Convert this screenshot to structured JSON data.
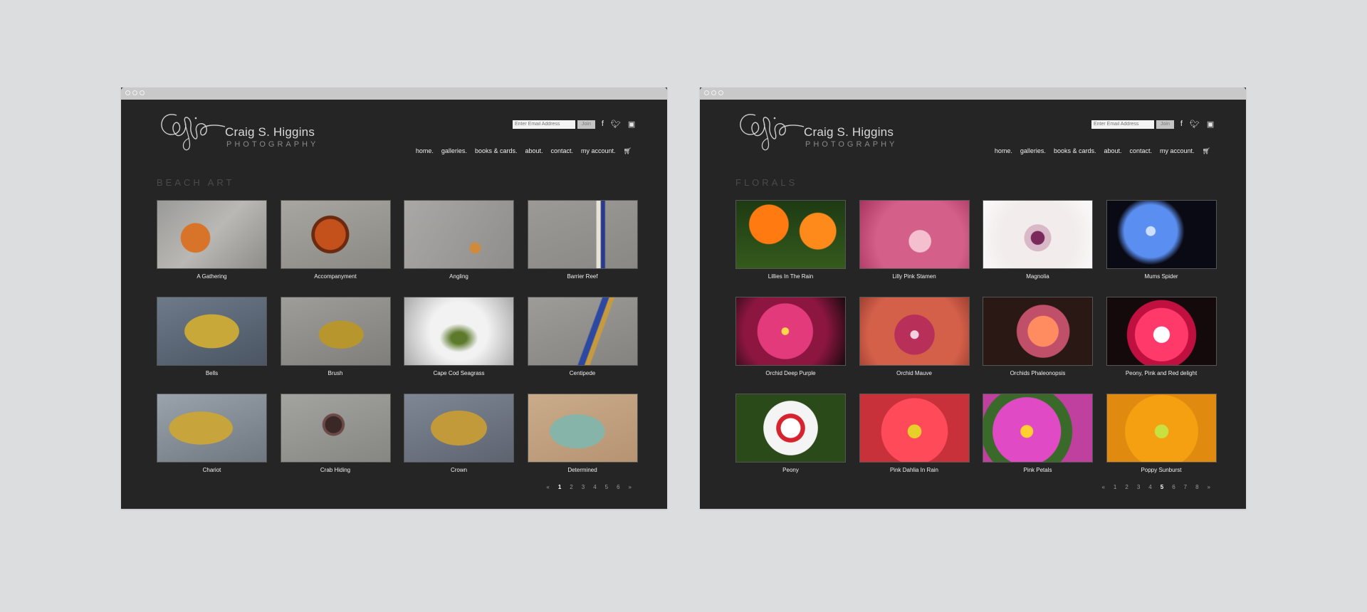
{
  "brand": {
    "name": "Craig S. Higgins",
    "sub": "PHOTOGRAPHY"
  },
  "signup": {
    "placeholder": "Enter Email Address",
    "button": "Join"
  },
  "social": [
    "facebook-icon",
    "twitter-icon",
    "instagram-icon"
  ],
  "nav": [
    "home.",
    "galleries.",
    "books & cards.",
    "about.",
    "contact.",
    "my account."
  ],
  "windows": [
    {
      "title": "BEACH ART",
      "items": [
        "A Gathering",
        "Accompanyment",
        "Angling",
        "Barrier Reef",
        "Bells",
        "Brush",
        "Cape Cod Seagrass",
        "Centipede",
        "Chariot",
        "Crab Hiding",
        "Crown",
        "Determined"
      ],
      "pager": {
        "prev": "«",
        "pages": [
          "1",
          "2",
          "3",
          "4",
          "5",
          "6"
        ],
        "current": "1",
        "next": "»"
      }
    },
    {
      "title": "FLORALS",
      "items": [
        "Lillies In The Rain",
        "Lilly Pink Stamen",
        "Magnolia",
        "Mums Spider",
        "Orchid Deep Purple",
        "Orchid Mauve",
        "Orchids Phaleonopsis",
        "Peony, Pink and Red delight",
        "Peony",
        "Pink Dahlia In Rain",
        "Pink Petals",
        "Poppy Sunburst"
      ],
      "pager": {
        "prev": "«",
        "pages": [
          "1",
          "2",
          "3",
          "4",
          "5",
          "6",
          "7",
          "8"
        ],
        "current": "5",
        "next": "»"
      }
    }
  ],
  "colors": {
    "page_bg": "#dcdddf",
    "window_bg": "#252525",
    "chrome": "#c9c9c9",
    "text": "#f0f0f0",
    "heading": "#4a4a4a"
  }
}
